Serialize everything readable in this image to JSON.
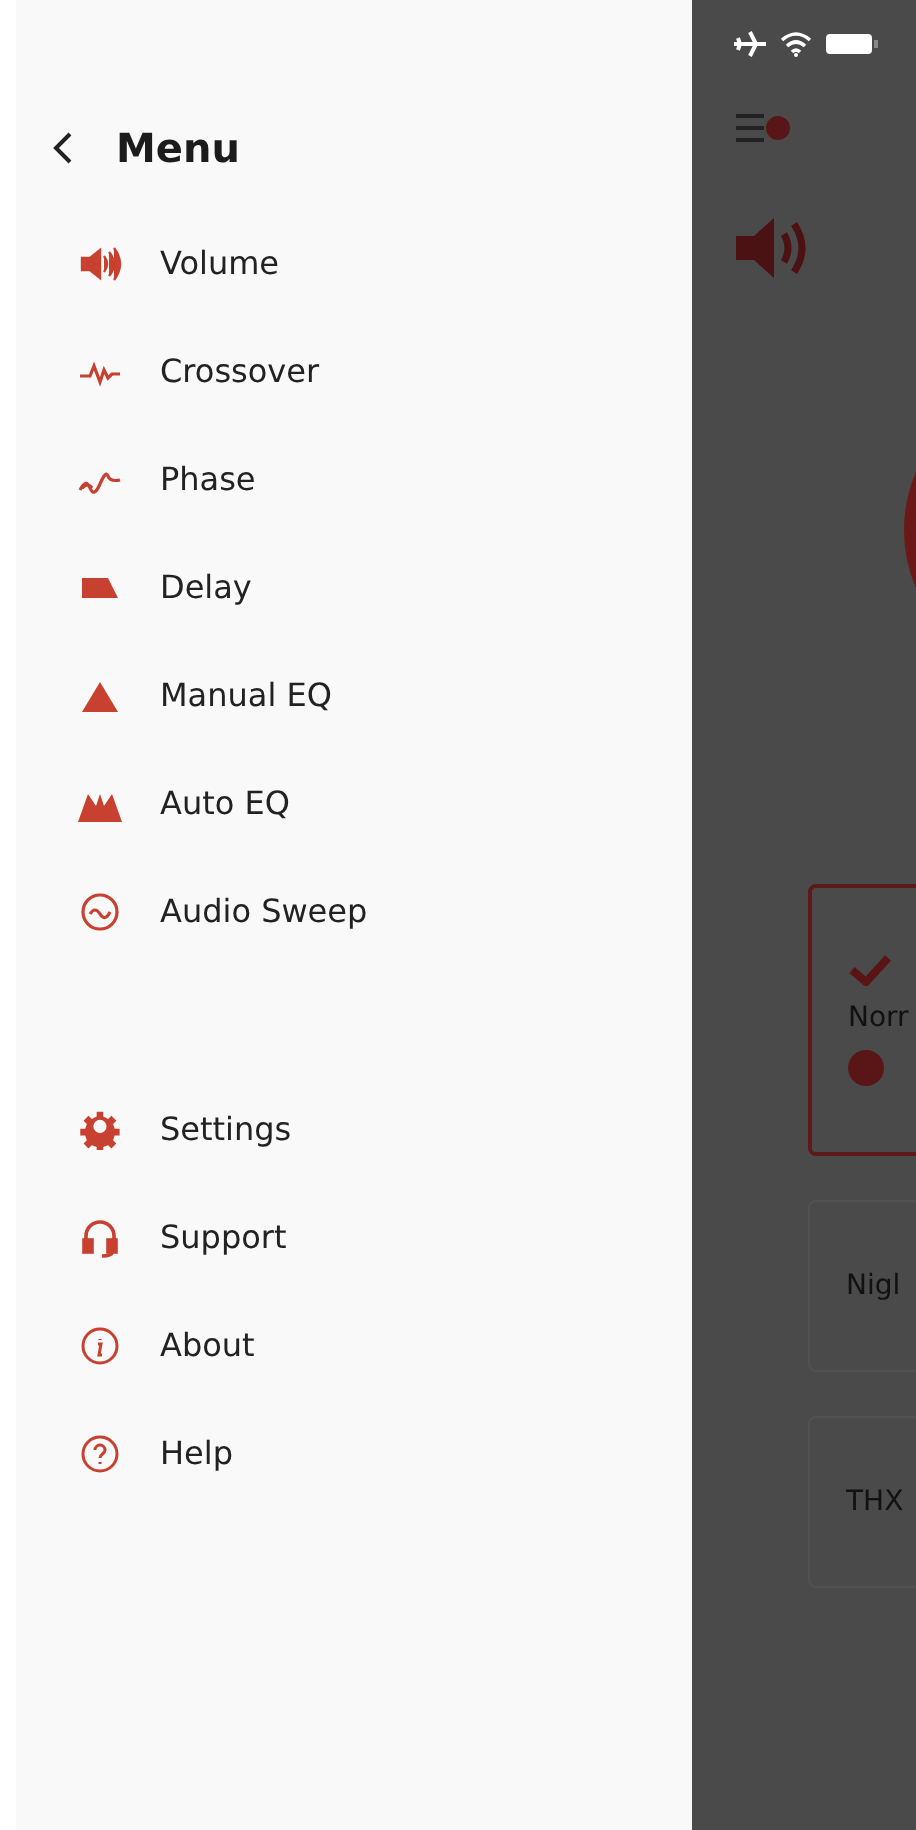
{
  "menu": {
    "title": "Menu",
    "sections": [
      {
        "items": [
          {
            "label": "Volume"
          },
          {
            "label": "Crossover"
          },
          {
            "label": "Phase"
          },
          {
            "label": "Delay"
          },
          {
            "label": "Manual EQ"
          },
          {
            "label": "Auto EQ"
          },
          {
            "label": "Audio Sweep"
          }
        ]
      },
      {
        "items": [
          {
            "label": "Settings"
          },
          {
            "label": "Support"
          },
          {
            "label": "About"
          },
          {
            "label": "Help"
          }
        ]
      }
    ]
  },
  "background_screen": {
    "modes": [
      {
        "label": "Norr",
        "selected": true
      },
      {
        "label": "Nigl",
        "selected": false
      },
      {
        "label": "THX",
        "selected": false
      }
    ]
  }
}
